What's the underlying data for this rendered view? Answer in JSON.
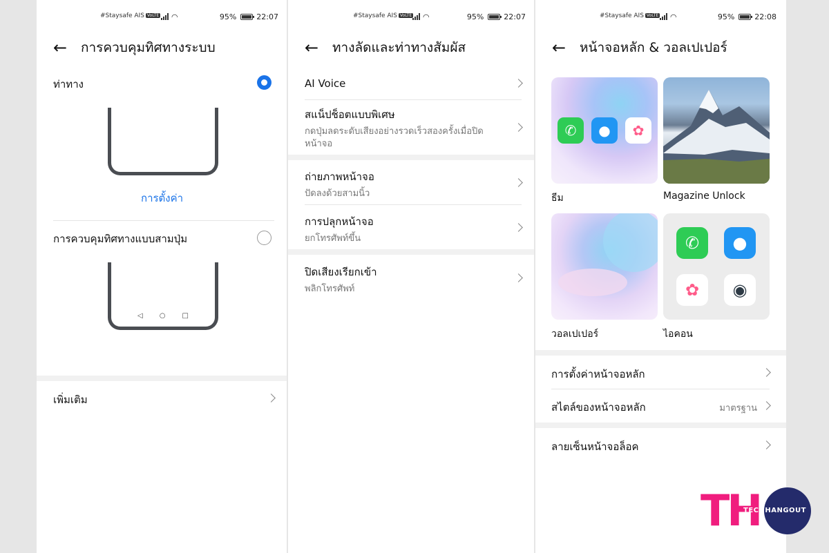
{
  "status": {
    "carrier": "#Staysafe AIS",
    "volte": "VoLTE",
    "battery": "95%",
    "time_1": "22:07",
    "time_2": "22:07",
    "time_3": "22:08"
  },
  "panel1": {
    "title": "การควบคุมทิศทางระบบ",
    "gesture_label": "ท่าทาง",
    "gesture_selected": true,
    "settings_link": "การตั้งค่า",
    "three_key_label": "การควบคุมทิศทางแบบสามปุ่ม",
    "three_key_selected": false,
    "nav_keys": [
      "◁",
      "○",
      "□"
    ],
    "more_label": "เพิ่มเติม"
  },
  "panel2": {
    "title": "ทางลัดและท่าทางสัมผัส",
    "items": [
      {
        "label": "AI Voice",
        "sub": ""
      },
      {
        "label": "สแน็ปช็อตแบบพิเศษ",
        "sub": "กดปุ่มลดระดับเสียงอย่างรวดเร็วสองครั้งเมื่อปิดหน้าจอ"
      },
      {
        "label": "ถ่ายภาพหน้าจอ",
        "sub": "ปัดลงด้วยสามนิ้ว"
      },
      {
        "label": "การปลุกหน้าจอ",
        "sub": "ยกโทรศัพท์ขึ้น"
      },
      {
        "label": "ปิดเสียงเรียกเข้า",
        "sub": "พลิกโทรศัพท์"
      }
    ]
  },
  "panel3": {
    "title": "หน้าจอหลัก & วอลเปเปอร์",
    "tiles": {
      "theme": "ธีม",
      "magazine": "Magazine Unlock",
      "wallpaper": "วอลเปเปอร์",
      "icons": "ไอคอน"
    },
    "home_settings": "การตั้งค่าหน้าจอหลัก",
    "home_style": "สไตล์ของหน้าจอหลัก",
    "home_style_value": "มาตรฐาน",
    "lock_signature": "ลายเซ็นหน้าจอล็อค"
  },
  "logo": {
    "mark": "TH",
    "text": "TECHHANGOUT"
  },
  "colors": {
    "accent": "#1a73e8",
    "logo_pink": "#f01d7e",
    "logo_navy": "#242b6b"
  },
  "icons": [
    "back-arrow-icon",
    "chevron-right-icon",
    "phone-icon",
    "message-icon",
    "photos-icon",
    "camera-icon",
    "wifi-icon",
    "signal-icon",
    "battery-icon"
  ]
}
